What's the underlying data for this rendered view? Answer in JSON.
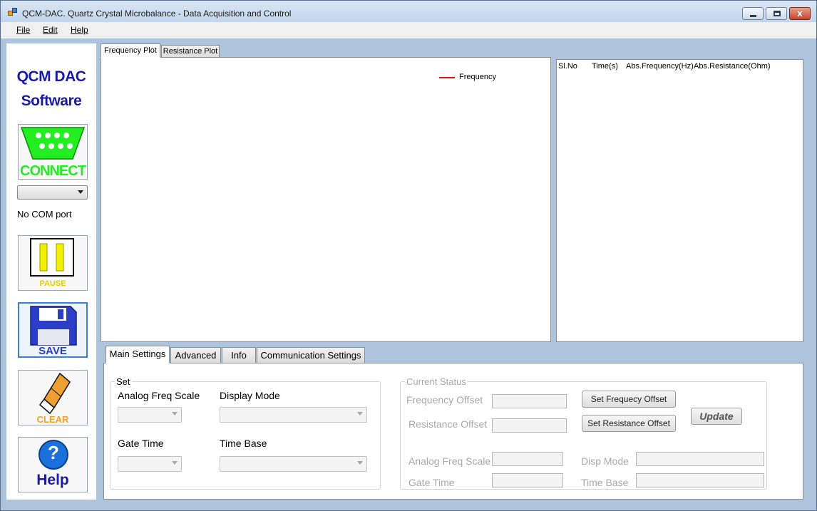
{
  "window": {
    "title": "QCM-DAC. Quartz Crystal Microbalance - Data Acquisition and Control",
    "close_glyph": "x"
  },
  "menu": {
    "file": "File",
    "edit": "Edit",
    "help": "Help"
  },
  "sidebar": {
    "logo_line1": "QCM DAC",
    "logo_line2": "Software",
    "connect_label": "CONNECT",
    "com_port_value": "",
    "com_status": "No COM port",
    "pause_label": "PAUSE",
    "save_label": "SAVE",
    "clear_label": "CLEAR",
    "help_label": "Help",
    "help_glyph": "?"
  },
  "plot": {
    "tabs": [
      "Frequency Plot",
      "Resistance Plot"
    ],
    "active_tab": 0,
    "legend": "Frequency",
    "series_color": "#e01010"
  },
  "table": {
    "columns": [
      "Sl.No",
      "Time(s)",
      "Abs.Frequency(Hz)",
      "Abs.Resistance(Ohm)"
    ],
    "rows": []
  },
  "settings": {
    "tabs": [
      "Main Settings",
      "Advanced",
      "Info",
      "Communication Settings"
    ],
    "active_tab": 0,
    "set_group": {
      "title": "Set",
      "analog_freq_scale": "Analog Freq Scale",
      "display_mode": "Display Mode",
      "gate_time": "Gate Time",
      "time_base": "Time Base"
    },
    "status_group": {
      "title": "Current Status",
      "frequency_offset": "Frequency Offset",
      "resistance_offset": "Resistance Offset",
      "set_freq_offset_button": "Set Frequecy Offset",
      "set_res_offset_button": "Set Resistance Offset",
      "update_button": "Update",
      "analog_freq_scale": "Analog Freq Scale",
      "disp_mode": "Disp Mode",
      "gate_time": "Gate Time",
      "time_base": "Time Base"
    }
  },
  "colors": {
    "window_bg": "#aec3dc",
    "logo_text": "#1a1aa8",
    "connect_green": "#22ee22",
    "pause_yellow": "#f0f000",
    "save_blue": "#2a3fc6",
    "clear_orange": "#f0a030"
  }
}
